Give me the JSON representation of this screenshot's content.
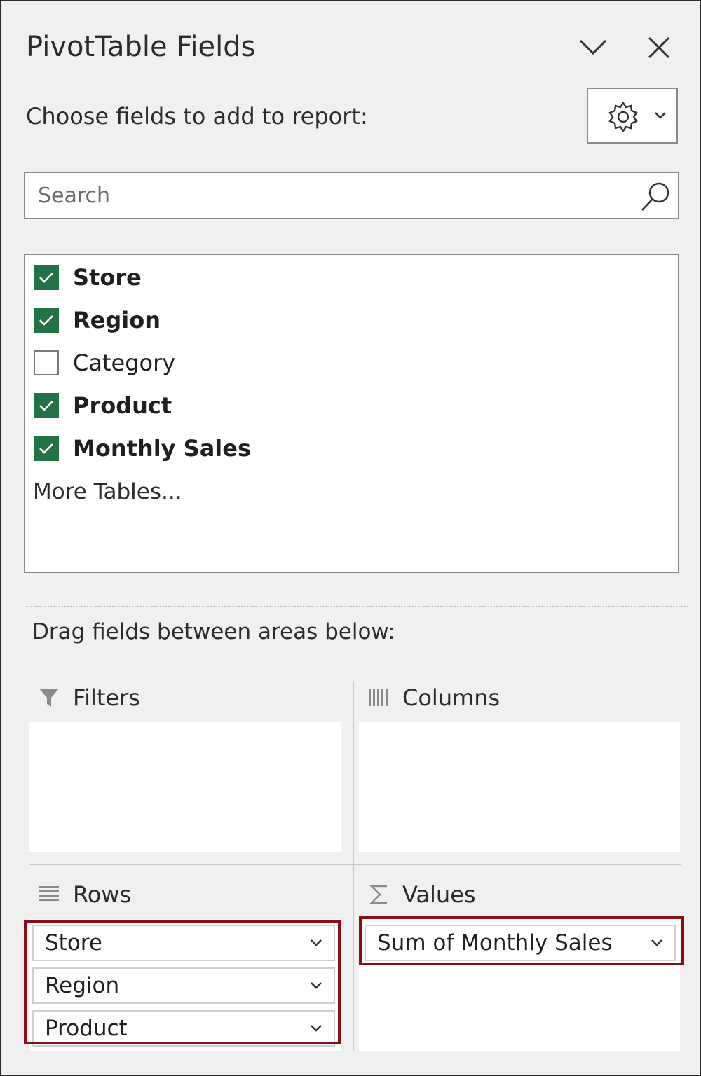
{
  "header": {
    "title": "PivotTable Fields",
    "choose_label": "Choose fields to add to report:"
  },
  "search": {
    "placeholder": "Search",
    "value": ""
  },
  "fields": [
    {
      "label": "Store",
      "checked": true
    },
    {
      "label": "Region",
      "checked": true
    },
    {
      "label": "Category",
      "checked": false
    },
    {
      "label": "Product",
      "checked": true
    },
    {
      "label": "Monthly Sales",
      "checked": true
    }
  ],
  "more_tables": "More Tables...",
  "drag_label": "Drag fields between areas below:",
  "areas": {
    "filters": {
      "label": "Filters",
      "items": []
    },
    "columns": {
      "label": "Columns",
      "items": []
    },
    "rows": {
      "label": "Rows",
      "items": [
        "Store",
        "Region",
        "Product"
      ]
    },
    "values": {
      "label": "Values",
      "items": [
        "Sum of Monthly Sales"
      ]
    }
  },
  "colors": {
    "checkbox_checked": "#217346",
    "highlight": "#8b0e12",
    "pane_background": "#f0f0f0"
  },
  "icons": [
    "chevron-down-icon",
    "close-icon",
    "gear-icon",
    "search-icon",
    "filter-icon",
    "columns-icon",
    "rows-icon",
    "sigma-icon"
  ]
}
